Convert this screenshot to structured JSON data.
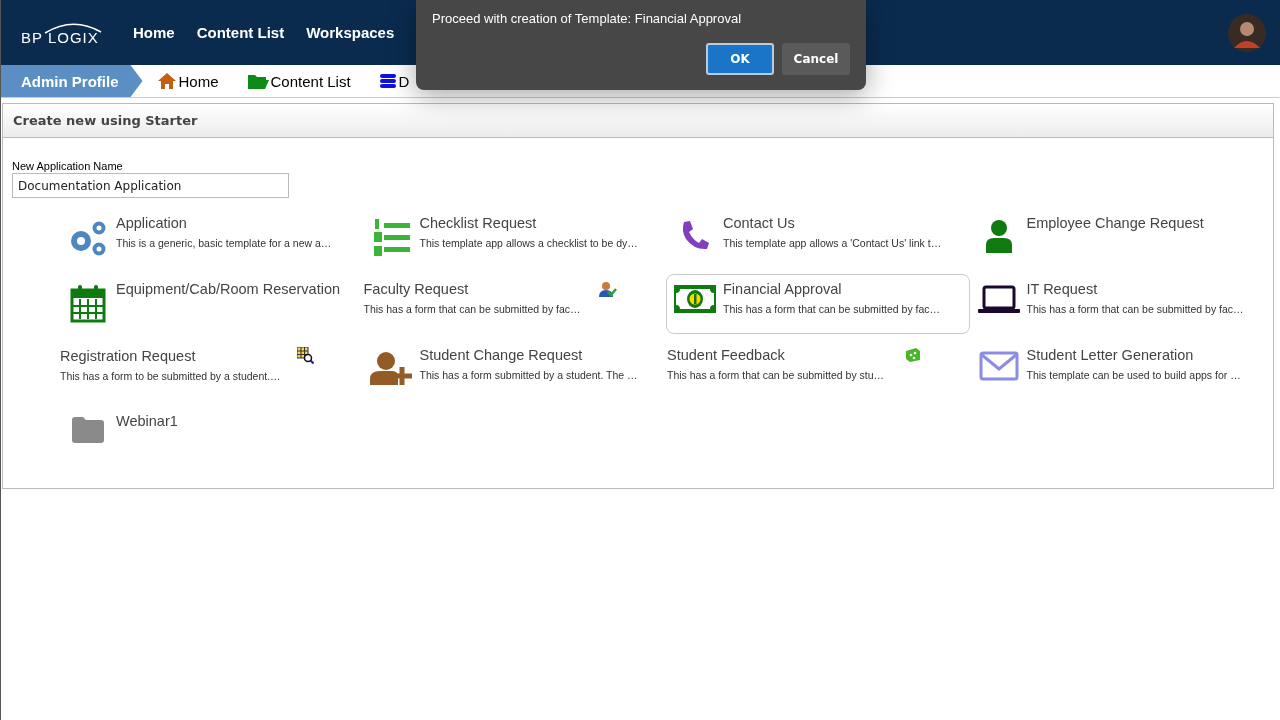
{
  "top_nav": {
    "logo": "BP LOGIX",
    "items": [
      {
        "label": "Home"
      },
      {
        "label": "Content List"
      },
      {
        "label": "Workspaces"
      }
    ]
  },
  "breadcrumb": {
    "profile": "Admin Profile",
    "items": [
      {
        "label": "Home"
      },
      {
        "label": "Content List"
      },
      {
        "label": "D"
      }
    ]
  },
  "panel": {
    "title": "Create new using Starter",
    "field_label": "New Application Name",
    "field_value": "Documentation Application"
  },
  "templates": [
    {
      "kind": "large",
      "title": "Application",
      "description": "This is a generic, basic template for a new a…",
      "selected": false
    },
    {
      "kind": "large",
      "title": "Checklist Request",
      "description": "This template app allows a checklist to be dy…",
      "selected": false
    },
    {
      "kind": "large",
      "title": "Contact Us",
      "description": "This template app allows a 'Contact Us' link t…",
      "selected": false
    },
    {
      "kind": "large",
      "title": "Employee Change Request",
      "selected": false
    },
    {
      "kind": "large",
      "title": "Equipment/Cab/Room Reservation",
      "selected": false
    },
    {
      "kind": "small",
      "title": "Faculty Request",
      "description": "This has a form that can be submitted by fac…",
      "selected": false
    },
    {
      "kind": "large",
      "title": "Financial Approval",
      "description": "This has a form that can be submitted by fac…",
      "selected": true
    },
    {
      "kind": "large",
      "title": "IT Request",
      "description": "This has a form that can be submitted by fac…",
      "selected": false
    },
    {
      "kind": "small",
      "title": "Registration Request",
      "description": "This has a form to be submitted by a student.…",
      "selected": false
    },
    {
      "kind": "large",
      "title": "Student Change Request",
      "description": "This has a form submitted by a student. The …",
      "selected": false
    },
    {
      "kind": "small",
      "title": "Student Feedback",
      "description": "This has a form that can be submitted by stu…",
      "selected": false
    },
    {
      "kind": "large",
      "title": "Student Letter Generation",
      "description": "This template can be used to build apps for …",
      "selected": false
    },
    {
      "kind": "large",
      "title": "Webinar1",
      "selected": false
    }
  ],
  "dialog": {
    "message": "Proceed with creation of Template: Financial Approval",
    "buttons": [
      {
        "label": "OK",
        "selected": true
      },
      {
        "label": "Cancel",
        "selected": false
      }
    ]
  }
}
